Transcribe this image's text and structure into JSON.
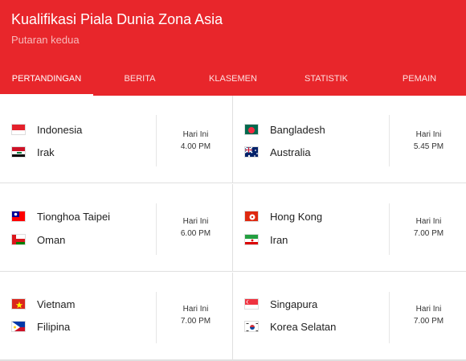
{
  "header": {
    "title": "Kualifikasi Piala Dunia Zona Asia",
    "subtitle": "Putaran kedua"
  },
  "tabs": [
    {
      "label": "PERTANDINGAN",
      "active": true
    },
    {
      "label": "BERITA"
    },
    {
      "label": "KLASEMEN"
    },
    {
      "label": "STATISTIK"
    },
    {
      "label": "PEMAIN"
    }
  ],
  "matches": [
    {
      "home": "Indonesia",
      "away": "Irak",
      "day": "Hari Ini",
      "time": "4.00 PM"
    },
    {
      "home": "Bangladesh",
      "away": "Australia",
      "day": "Hari Ini",
      "time": "5.45 PM"
    },
    {
      "home": "Tionghoa Taipei",
      "away": "Oman",
      "day": "Hari Ini",
      "time": "6.00 PM"
    },
    {
      "home": "Hong Kong",
      "away": "Iran",
      "day": "Hari Ini",
      "time": "7.00 PM"
    },
    {
      "home": "Vietnam",
      "away": "Filipina",
      "day": "Hari Ini",
      "time": "7.00 PM"
    },
    {
      "home": "Singapura",
      "away": "Korea Selatan",
      "day": "Hari Ini",
      "time": "7.00 PM"
    }
  ],
  "colors": {
    "accent": "#e8262b"
  }
}
